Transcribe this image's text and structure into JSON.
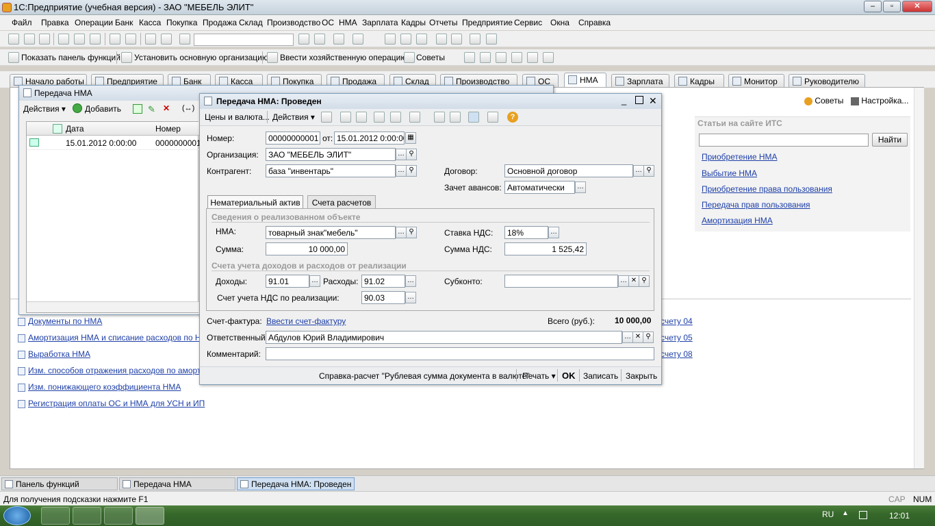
{
  "app": {
    "title": "1С:Предприятие (учебная версия) - ЗАО \"МЕБЕЛЬ ЭЛИТ\""
  },
  "menu": [
    "Файл",
    "Правка",
    "Операции",
    "Банк",
    "Касса",
    "Покупка",
    "Продажа",
    "Склад",
    "Производство",
    "ОС",
    "НМА",
    "Зарплата",
    "Кадры",
    "Отчеты",
    "Предприятие",
    "Сервис",
    "Окна",
    "Справка"
  ],
  "functions_bar": {
    "show_panel": "Показать панель функций",
    "set_org": "Установить основную организацию",
    "enter_op": "Ввести хозяйственную операцию",
    "tips": "Советы"
  },
  "tabs": [
    "Начало работы",
    "Предприятие",
    "Банк",
    "Касса",
    "Покупка",
    "Продажа",
    "Склад",
    "Производство",
    "ОС",
    "НМА",
    "Зарплата",
    "Кадры",
    "Монитор",
    "Руководителю"
  ],
  "panel": {
    "sovety": "Советы",
    "nastroyka": "Настройка...",
    "its_header": "Статьи на сайте ИТС",
    "find_btn": "Найти",
    "its_links": [
      "Приобретение НМА",
      "Выбытие НМА ",
      "Приобретение права пользования",
      "Передача прав пользования",
      "Амортизация НМА"
    ],
    "left_links": [
      "Документы по НМА",
      "Амортизация НМА и списание расходов по НИОКР",
      "Выработка НМА",
      "Изм. способов отражения расходов по аморт. НМА",
      "Изм. понижающего коэффициента НМА",
      "Регистрация оплаты ОС и НМА для УСН и ИП"
    ],
    "right_links": [
      "счету 04",
      "счету 05",
      "счету 08"
    ]
  },
  "list_win": {
    "title": "Передача НМА",
    "actions": "Действия",
    "add": "Добавить",
    "col_date": "Дата",
    "col_num": "Номер",
    "row_date": "15.01.2012 0:00:00",
    "row_num": "0000000001"
  },
  "doc": {
    "title": "Передача НМА: Проведен",
    "prices_btn": "Цены и валюта...",
    "actions": "Действия",
    "number_label": "Номер:",
    "number": "00000000001",
    "from_label": "от:",
    "date": "15.01.2012  0:00:00",
    "org_label": "Организация:",
    "org": "ЗАО \"МЕБЕЛЬ ЭЛИТ\"",
    "contr_label": "Контрагент:",
    "contr": "база \"инвентарь\"",
    "dog_label": "Договор:",
    "dog": "Основной договор",
    "avans_label": "Зачет авансов:",
    "avans": "Автоматически",
    "tab1": "Нематериальный актив",
    "tab2": "Счета расчетов",
    "grp1": "Сведения о реализованном объекте",
    "nma_label": "НМА:",
    "nma": "товарный знак\"мебель\"",
    "stavka_label": "Ставка НДС:",
    "stavka": "18%",
    "summa_label": "Сумма:",
    "summa": "10 000,00",
    "summa_nds_label": "Сумма НДС:",
    "summa_nds": "1 525,42",
    "grp2": "Счета учета доходов и расходов от реализации",
    "dohody_label": "Доходы:",
    "dohody": "91.01",
    "rashody_label": "Расходы:",
    "rashody": "91.02",
    "subkonto_label": "Субконто:",
    "nds_acc_label": "Счет учета НДС по реализации:",
    "nds_acc": "90.03",
    "sf_label": "Счет-фактура:",
    "sf_link": "Ввести счет-фактуру",
    "total_label": "Всего (руб.):",
    "total": "10 000,00",
    "resp_label": "Ответственный:",
    "resp": "Абдулов Юрий Владимирович",
    "comment_label": "Комментарий:",
    "spravka": "Справка-расчет \"Рублевая сумма документа в валюте\"",
    "print": "Печать",
    "ok": "OK",
    "save": "Записать",
    "close": "Закрыть"
  },
  "windows_bar": [
    "Панель функций",
    "Передача НМА",
    "Передача НМА: Проведен"
  ],
  "status": {
    "hint": "Для получения подсказки нажмите F1",
    "cap": "CAP",
    "num": "NUM"
  },
  "tray": {
    "lang": "RU",
    "time": "12:01"
  }
}
